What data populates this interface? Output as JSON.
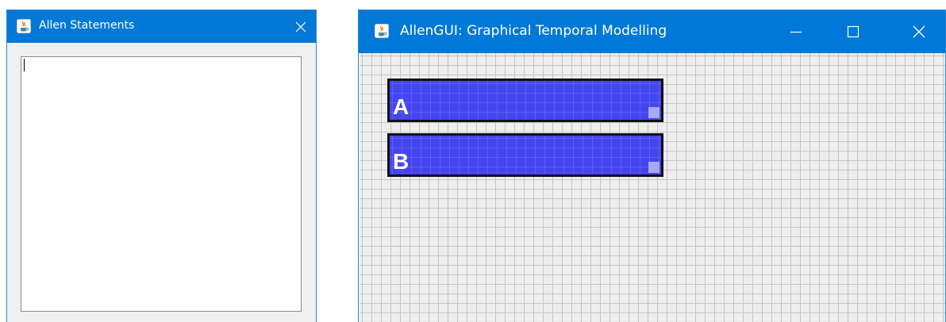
{
  "statements_window": {
    "title": "Allen Statements",
    "close_icon": "close-icon",
    "app_icon": "java-cup-icon",
    "text_value": ""
  },
  "allengui_window": {
    "title": "AllenGUI: Graphical Temporal Modelling",
    "app_icon": "java-cup-icon",
    "controls": [
      "minimize-icon",
      "maximize-icon",
      "close-icon"
    ],
    "intervals": [
      {
        "label": "A"
      },
      {
        "label": "B"
      }
    ]
  },
  "colors": {
    "titlebar": "#0078d7",
    "canvas_background": "#eeeeee",
    "grid_line": "#c4c4c4",
    "interval_fill": "#4545f0",
    "interval_border": "#111111",
    "resize_handle": "#a8a8f2"
  }
}
